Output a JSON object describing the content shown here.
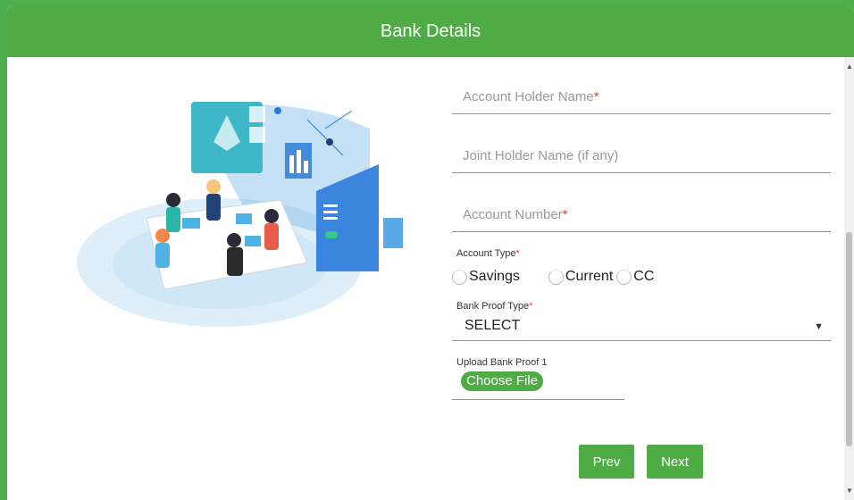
{
  "header": {
    "title": "Bank Details"
  },
  "form": {
    "account_holder_placeholder": "Account Holder Name",
    "joint_holder_placeholder": "Joint Holder Name (if any)",
    "account_number_placeholder": "Account Number",
    "required_mark": "*",
    "account_type_label": "Account Type",
    "account_type_options": [
      "Savings",
      "Current",
      "CC"
    ],
    "bank_proof_type_label": "Bank Proof Type",
    "bank_proof_type_value": "SELECT",
    "upload_label": "Upload Bank Proof 1",
    "choose_file_label": "Choose File"
  },
  "buttons": {
    "prev": "Prev",
    "next": "Next"
  },
  "colors": {
    "brand_green": "#4fac45",
    "required_red": "#e53935"
  },
  "icons": {
    "select_caret": "▼"
  }
}
